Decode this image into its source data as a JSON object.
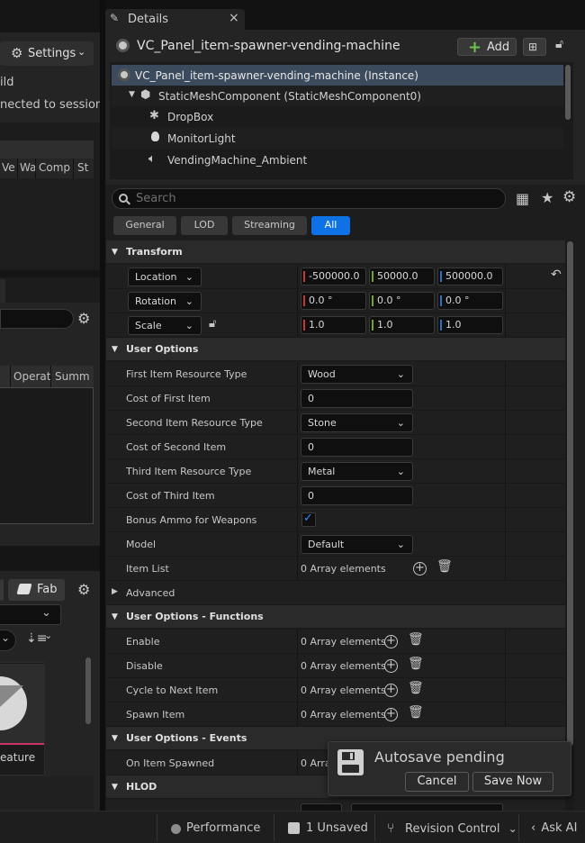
{
  "left": {
    "settings_label": "Settings",
    "build_text_fragment": "ild",
    "session_text_fragment": "nected to session.",
    "table1_cols": [
      "Ve",
      "Wa",
      "Comp",
      "St"
    ],
    "table2_cols": [
      "Operat",
      "Summ"
    ],
    "fab_label": "Fab",
    "asset_label_fragment": "eature"
  },
  "details": {
    "tab_title": "Details",
    "tab_close": "×",
    "actor_name": "VC_Panel_item-spawner-vending-machine",
    "add_label": "Add",
    "tree": [
      {
        "label": "VC_Panel_item-spawner-vending-machine (Instance)",
        "icon": "actor-icon"
      },
      {
        "label": "StaticMeshComponent (StaticMeshComponent0)",
        "icon": "static-mesh-icon"
      },
      {
        "label": "DropBox",
        "icon": "dropbox-icon"
      },
      {
        "label": "MonitorLight",
        "icon": "light-bulb-icon"
      },
      {
        "label": "VendingMachine_Ambient",
        "icon": "speaker-icon"
      }
    ],
    "search_placeholder": "Search",
    "filter_tabs": [
      "General",
      "LOD",
      "Streaming",
      "All"
    ],
    "active_filter": "All",
    "transform": {
      "header": "Transform",
      "location_label": "Location",
      "rotation_label": "Rotation",
      "scale_label": "Scale",
      "location": [
        "-500000.0",
        "50000.0",
        "500000.0"
      ],
      "rotation": [
        "0.0 °",
        "0.0 °",
        "0.0 °"
      ],
      "scale": [
        "1.0",
        "1.0",
        "1.0"
      ]
    },
    "user_options": {
      "header": "User Options",
      "first_item_type_label": "First Item Resource Type",
      "first_item_type": "Wood",
      "cost_first_label": "Cost of First Item",
      "cost_first": "0",
      "second_item_type_label": "Second Item Resource Type",
      "second_item_type": "Stone",
      "cost_second_label": "Cost of Second Item",
      "cost_second": "0",
      "third_item_type_label": "Third Item Resource Type",
      "third_item_type": "Metal",
      "cost_third_label": "Cost of Third Item",
      "cost_third": "0",
      "bonus_ammo_label": "Bonus Ammo for Weapons",
      "model_label": "Model",
      "model": "Default",
      "item_list_label": "Item List",
      "item_list_value": "0 Array elements",
      "advanced_label": "Advanced"
    },
    "functions": {
      "header": "User Options - Functions",
      "rows": [
        {
          "label": "Enable",
          "value": "0 Array elements"
        },
        {
          "label": "Disable",
          "value": "0 Array elements"
        },
        {
          "label": "Cycle to Next Item",
          "value": "0 Array elements"
        },
        {
          "label": "Spawn Item",
          "value": "0 Array elements"
        }
      ]
    },
    "events": {
      "header": "User Options - Events",
      "on_item_spawned_label": "On Item Spawned",
      "on_item_spawned_value": "0 Arra"
    },
    "hlod_header": "HLOD"
  },
  "autosave": {
    "title": "Autosave pending",
    "cancel_label": "Cancel",
    "save_label": "Save Now"
  },
  "statusbar": {
    "performance": "Performance",
    "unsaved": "1 Unsaved",
    "revision": "Revision Control",
    "ask_ai": "Ask AI"
  }
}
